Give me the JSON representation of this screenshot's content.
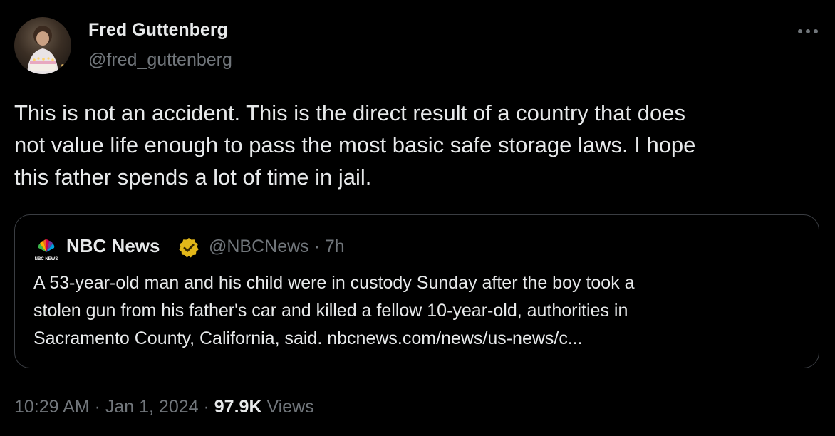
{
  "author": {
    "name": "Fred Guttenberg",
    "handle": "@fred_guttenberg",
    "avatar_icon": "profile-photo"
  },
  "more_icon": "more-horizontal-icon",
  "tweet": {
    "lines": [
      "This is not an accident.  This is the direct result of a country that does",
      "not value life enough to pass the most basic safe storage laws.  I hope",
      "this father spends a lot of time in jail."
    ]
  },
  "quoted": {
    "logo_icon": "nbc-peacock-logo",
    "logo_text": "NBC NEWS",
    "name": "NBC News",
    "verified_icon": "gold-verified-badge-icon",
    "verified_color": "#e2b719",
    "handle_time": "@NBCNews · 7h",
    "lines": [
      "A 53-year-old man and his child were in custody Sunday after the boy took a",
      "stolen gun from his father's car and killed a fellow 10-year-old, authorities in",
      "Sacramento County, California, said. nbcnews.com/news/us-news/c..."
    ]
  },
  "meta": {
    "time": "10:29 AM",
    "separator": "·",
    "date": "Jan 1, 2024",
    "views_count": "97.9K",
    "views_label": "Views"
  },
  "colors": {
    "background": "#000000",
    "text": "#e7e9ea",
    "secondary": "#71767b",
    "border": "#3a3d42"
  }
}
